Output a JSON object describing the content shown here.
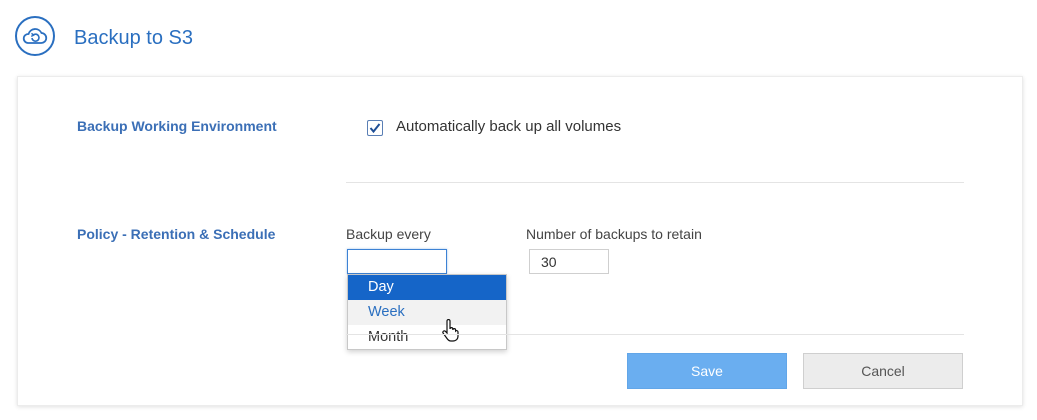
{
  "header": {
    "title": "Backup to S3",
    "icon": "cloud-backup-icon",
    "accent_color": "#2a6fc0"
  },
  "sections": {
    "working_environment": {
      "label": "Backup Working Environment",
      "checkbox_label": "Automatically back up all volumes",
      "checked": true
    },
    "policy": {
      "label": "Policy - Retention & Schedule",
      "backup_every_label": "Backup every",
      "backup_every_value": "",
      "retain_label": "Number of backups to retain",
      "retain_value": "30",
      "options": [
        {
          "label": "Day",
          "state": "selected"
        },
        {
          "label": "Week",
          "state": "hover"
        },
        {
          "label": "Month",
          "state": "normal"
        }
      ]
    }
  },
  "buttons": {
    "save": "Save",
    "cancel": "Cancel"
  },
  "colors": {
    "selected_option": "#1565c8",
    "save_button": "#6aaef0",
    "section_label": "#3b6fb6"
  }
}
